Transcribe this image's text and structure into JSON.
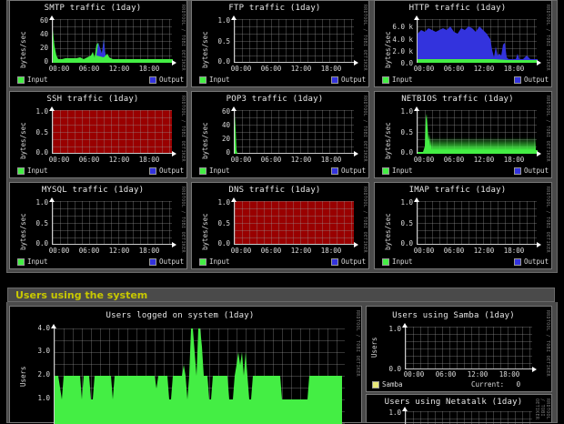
{
  "colors": {
    "input": "#44ee44",
    "output": "#3333dd",
    "red_fill": "#990000"
  },
  "panels": [
    {
      "id": "smtp",
      "title": "SMTP traffic  (1day)",
      "ylabel": "bytes/sec",
      "side": "RRDTOOL / TOBI OETIKER",
      "yticks": [
        "60",
        "40",
        "20",
        "0"
      ],
      "xticks": [
        "00:00",
        "06:00",
        "12:00",
        "18:00"
      ],
      "legend_in": "Input",
      "legend_out": "Output"
    },
    {
      "id": "ftp",
      "title": "FTP traffic  (1day)",
      "ylabel": "bytes/sec",
      "side": "RRDTOOL / TOBI OETIKER",
      "yticks": [
        "1.0",
        "0.5",
        "0.0"
      ],
      "xticks": [
        "00:00",
        "06:00",
        "12:00",
        "18:00"
      ],
      "legend_in": "Input",
      "legend_out": "Output"
    },
    {
      "id": "http",
      "title": "HTTP traffic  (1day)",
      "ylabel": "bytes/sec",
      "side": "RRDTOOL / TOBI OETIKER",
      "yticks": [
        "6.0 k",
        "4.0 k",
        "2.0 k",
        "0.0"
      ],
      "xticks": [
        "00:00",
        "06:00",
        "12:00",
        "18:00"
      ],
      "legend_in": "Input",
      "legend_out": "Output"
    },
    {
      "id": "ssh",
      "title": "SSH traffic  (1day)",
      "ylabel": "bytes/sec",
      "side": "RRDTOOL / TOBI OETIKER",
      "yticks": [
        "1.0",
        "0.5",
        "0.0"
      ],
      "xticks": [
        "00:00",
        "06:00",
        "12:00",
        "18:00"
      ],
      "legend_in": "Input",
      "legend_out": "Output"
    },
    {
      "id": "pop3",
      "title": "POP3 traffic  (1day)",
      "ylabel": "bytes/sec",
      "side": "RRDTOOL / TOBI OETIKER",
      "yticks": [
        "60",
        "40",
        "20",
        "0"
      ],
      "xticks": [
        "00:00",
        "06:00",
        "12:00",
        "18:00"
      ],
      "legend_in": "Input",
      "legend_out": "Output"
    },
    {
      "id": "netbios",
      "title": "NETBIOS traffic  (1day)",
      "ylabel": "bytes/sec",
      "side": "RRDTOOL / TOBI OETIKER",
      "yticks": [
        "1.0",
        "0.5",
        "0.0"
      ],
      "xticks": [
        "00:00",
        "06:00",
        "12:00",
        "18:00"
      ],
      "legend_in": "Input",
      "legend_out": "Output"
    },
    {
      "id": "mysql",
      "title": "MYSQL traffic  (1day)",
      "ylabel": "bytes/sec",
      "side": "RRDTOOL / TOBI OETIKER",
      "yticks": [
        "1.0",
        "0.5",
        "0.0"
      ],
      "xticks": [
        "00:00",
        "06:00",
        "12:00",
        "18:00"
      ],
      "legend_in": "Input",
      "legend_out": "Output"
    },
    {
      "id": "dns",
      "title": "DNS traffic  (1day)",
      "ylabel": "bytes/sec",
      "side": "RRDTOOL / TOBI OETIKER",
      "yticks": [
        "1.0",
        "0.5",
        "0.0"
      ],
      "xticks": [
        "00:00",
        "06:00",
        "12:00",
        "18:00"
      ],
      "legend_in": "Input",
      "legend_out": "Output"
    },
    {
      "id": "imap",
      "title": "IMAP traffic  (1day)",
      "ylabel": "bytes/sec",
      "side": "RRDTOOL / TOBI OETIKER",
      "yticks": [
        "1.0",
        "0.5",
        "0.0"
      ],
      "xticks": [
        "00:00",
        "06:00",
        "12:00",
        "18:00"
      ],
      "legend_in": "Input",
      "legend_out": "Output"
    }
  ],
  "users_section": {
    "heading": "Users using the system"
  },
  "users_logged": {
    "title": "Users logged on system  (1day)",
    "ylabel": "Users",
    "side": "RRDTOOL / TOBI OETIKER",
    "yticks": [
      "4.0",
      "3.0",
      "2.0",
      "1.0"
    ]
  },
  "samba": {
    "title": "Users using Samba  (1day)",
    "ylabel": "Users",
    "side": "RRDTOOL / TOBI OETIKER",
    "yticks": [
      "1.0",
      "0.0"
    ],
    "xticks": [
      "00:00",
      "06:00",
      "12:00",
      "18:00"
    ],
    "legend": "Samba",
    "current_label": "Current:",
    "current_value": "0"
  },
  "netatalk": {
    "title": "Users using Netatalk  (1day)",
    "ylabel": "",
    "side": "RRDTOOL / TOBI OETIKER",
    "yticks": [
      "1.0"
    ]
  }
}
